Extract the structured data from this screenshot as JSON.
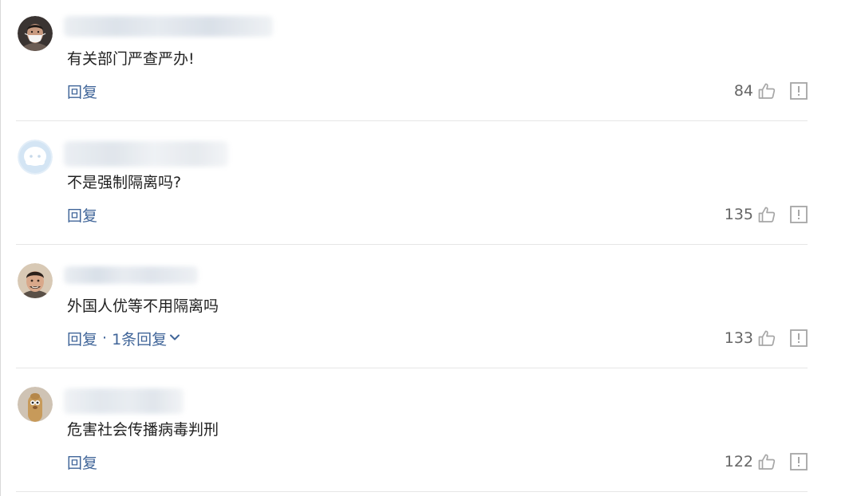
{
  "comments": [
    {
      "text": "不是强制隔离吗?",
      "reply_label": "回复",
      "replies_label": "",
      "likes": "135",
      "avatar": "placeholder-avatar"
    },
    {
      "text": "外国人优等不用隔离吗",
      "reply_label": "回复",
      "replies_label": "1条回复",
      "likes": "133",
      "avatar": "man-portrait-avatar"
    },
    {
      "text": "危害社会传播病毒判刑",
      "reply_label": "回复",
      "replies_label": "",
      "likes": "122",
      "avatar": "cartoon-animal-avatar"
    },
    {
      "text": "有关部门严查严办!",
      "reply_label": "回复",
      "replies_label": "",
      "likes": "84",
      "avatar": "masked-person-avatar"
    }
  ],
  "separator": "·",
  "colors": {
    "link": "#406599",
    "text": "#222222",
    "count": "#666666",
    "icon": "#a6a6a6",
    "divider": "#e6e6e6"
  },
  "icons": {
    "like": "thumbs-up-icon",
    "report": "report-icon",
    "expand": "chevron-down-icon"
  }
}
